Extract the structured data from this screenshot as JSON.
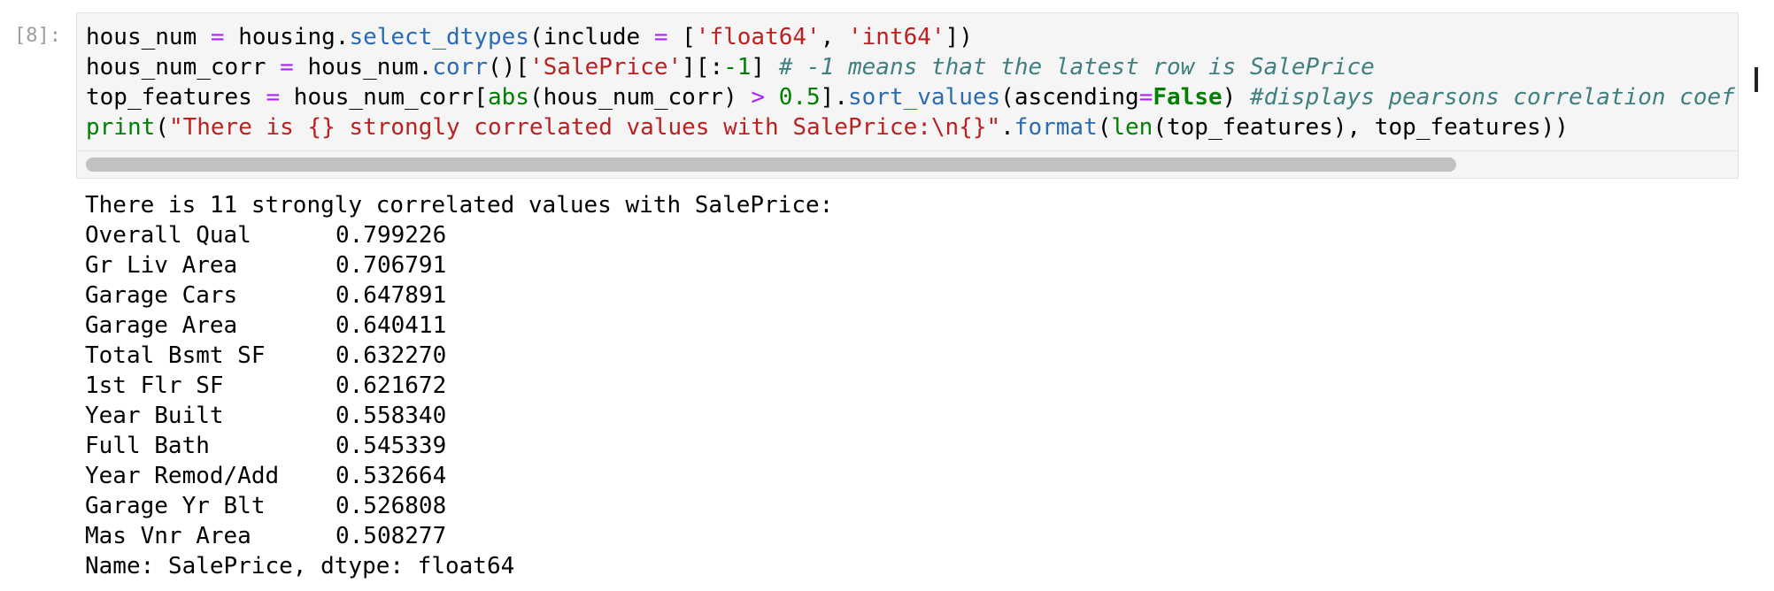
{
  "cell": {
    "prompt": "[8]:",
    "code_lines": [
      [
        {
          "t": "hous_num ",
          "c": "plain"
        },
        {
          "t": "=",
          "c": "op"
        },
        {
          "t": " housing.",
          "c": "plain"
        },
        {
          "t": "select_dtypes",
          "c": "fn"
        },
        {
          "t": "(include ",
          "c": "plain"
        },
        {
          "t": "=",
          "c": "op"
        },
        {
          "t": " [",
          "c": "plain"
        },
        {
          "t": "'float64'",
          "c": "str"
        },
        {
          "t": ", ",
          "c": "plain"
        },
        {
          "t": "'int64'",
          "c": "str"
        },
        {
          "t": "])",
          "c": "plain"
        }
      ],
      [
        {
          "t": "hous_num_corr ",
          "c": "plain"
        },
        {
          "t": "=",
          "c": "op"
        },
        {
          "t": " hous_num.",
          "c": "plain"
        },
        {
          "t": "corr",
          "c": "fn"
        },
        {
          "t": "()[",
          "c": "plain"
        },
        {
          "t": "'SalePrice'",
          "c": "str"
        },
        {
          "t": "][:",
          "c": "plain"
        },
        {
          "t": "-1",
          "c": "num"
        },
        {
          "t": "] ",
          "c": "plain"
        },
        {
          "t": "# -1 means that the latest row is SalePrice",
          "c": "cm"
        }
      ],
      [
        {
          "t": "top_features ",
          "c": "plain"
        },
        {
          "t": "=",
          "c": "op"
        },
        {
          "t": " hous_num_corr[",
          "c": "plain"
        },
        {
          "t": "abs",
          "c": "bi"
        },
        {
          "t": "(hous_num_corr) ",
          "c": "plain"
        },
        {
          "t": ">",
          "c": "op"
        },
        {
          "t": " ",
          "c": "plain"
        },
        {
          "t": "0.5",
          "c": "num"
        },
        {
          "t": "].",
          "c": "plain"
        },
        {
          "t": "sort_values",
          "c": "fn"
        },
        {
          "t": "(ascending",
          "c": "plain"
        },
        {
          "t": "=",
          "c": "op"
        },
        {
          "t": "False",
          "c": "kw"
        },
        {
          "t": ") ",
          "c": "plain"
        },
        {
          "t": "#displays pearsons correlation coef",
          "c": "cm"
        }
      ],
      [
        {
          "t": "print",
          "c": "bi"
        },
        {
          "t": "(",
          "c": "plain"
        },
        {
          "t": "\"There is {} strongly correlated values with SalePrice:\\n{}\"",
          "c": "str"
        },
        {
          "t": ".",
          "c": "plain"
        },
        {
          "t": "format",
          "c": "fn"
        },
        {
          "t": "(",
          "c": "plain"
        },
        {
          "t": "len",
          "c": "bi"
        },
        {
          "t": "(top_features), top_features))",
          "c": "plain"
        }
      ]
    ]
  },
  "output": {
    "header": "There is 11 strongly correlated values with SalePrice:",
    "rows": [
      {
        "name": "Overall Qual",
        "value": "0.799226"
      },
      {
        "name": "Gr Liv Area",
        "value": "0.706791"
      },
      {
        "name": "Garage Cars",
        "value": "0.647891"
      },
      {
        "name": "Garage Area",
        "value": "0.640411"
      },
      {
        "name": "Total Bsmt SF",
        "value": "0.632270"
      },
      {
        "name": "1st Flr SF",
        "value": "0.621672"
      },
      {
        "name": "Year Built",
        "value": "0.558340"
      },
      {
        "name": "Full Bath",
        "value": "0.545339"
      },
      {
        "name": "Year Remod/Add",
        "value": "0.532664"
      },
      {
        "name": "Garage Yr Blt",
        "value": "0.526808"
      },
      {
        "name": "Mas Vnr Area",
        "value": "0.508277"
      }
    ],
    "footer": "Name: SalePrice, dtype: float64"
  },
  "colors": {
    "function": "#2b6bb2",
    "string": "#ba2121",
    "number": "#008000",
    "operator": "#aa22ff",
    "comment": "#408080",
    "keyword": "#008000"
  }
}
